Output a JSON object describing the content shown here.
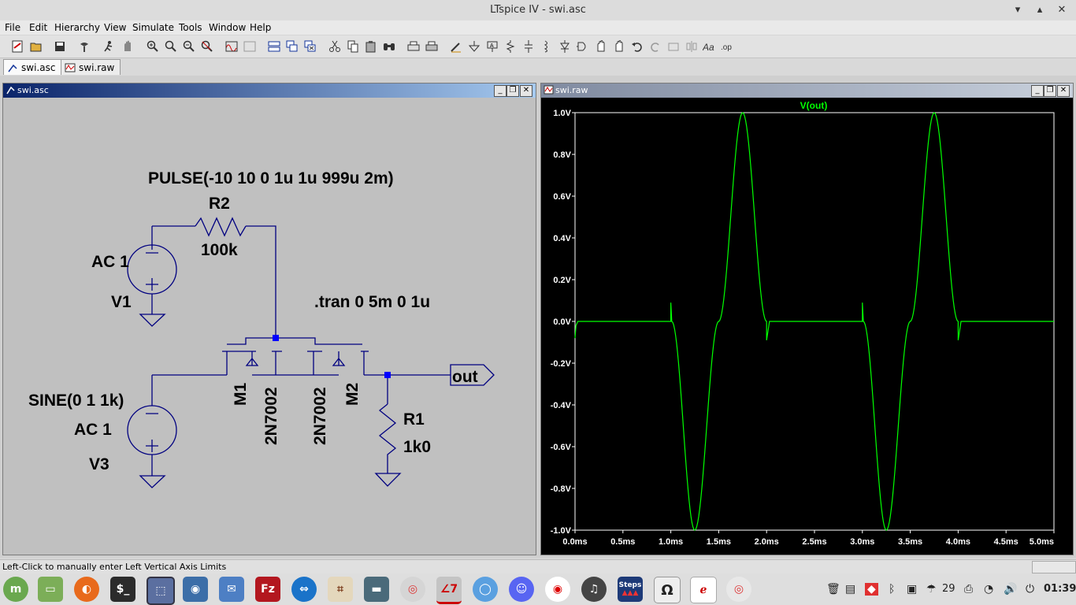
{
  "window": {
    "title": "LTspice IV - swi.asc"
  },
  "menu": [
    "File",
    "Edit",
    "Hierarchy",
    "View",
    "Simulate",
    "Tools",
    "Window",
    "Help"
  ],
  "tabs": [
    {
      "label": "swi.asc",
      "active": true
    },
    {
      "label": "swi.raw",
      "active": false
    }
  ],
  "schematic": {
    "window_title": "swi.asc",
    "pulse_label": "PULSE(-10 10 0 1u 1u 999u 2m)",
    "r2_name": "R2",
    "r2_value": "100k",
    "v1_ac": "AC 1",
    "v1_name": "V1",
    "tran": ".tran 0 5m 0 1u",
    "sine_label": "SINE(0 1 1k)",
    "v3_ac": "AC 1",
    "v3_name": "V3",
    "m1_name": "M1",
    "m1_model": "2N7002",
    "m2_model": "2N7002",
    "m2_name": "M2",
    "out_label": "out",
    "r1_name": "R1",
    "r1_value": "1k0"
  },
  "waveform": {
    "window_title": "swi.raw",
    "trace_label": "V(out)",
    "trace_color": "#00ff00"
  },
  "chart_data": {
    "type": "line",
    "title": "V(out)",
    "xlabel": "",
    "ylabel": "",
    "xlim": [
      0,
      5.0
    ],
    "ylim": [
      -1.0,
      1.0
    ],
    "x_ticks": [
      "0.0ms",
      "0.5ms",
      "1.0ms",
      "1.5ms",
      "2.0ms",
      "2.5ms",
      "3.0ms",
      "3.5ms",
      "4.0ms",
      "4.5ms",
      "5.0ms"
    ],
    "y_ticks": [
      "1.0V",
      "0.8V",
      "0.6V",
      "0.4V",
      "0.2V",
      "0.0V",
      "-0.2V",
      "-0.4V",
      "-0.6V",
      "-0.8V",
      "-1.0V"
    ],
    "series": [
      {
        "name": "V(out)",
        "x": [
          0,
          0.01,
          0.03,
          0.1,
          1.0,
          1.0,
          1.01,
          1.25,
          1.5,
          1.75,
          2.0,
          2.0,
          2.03,
          2.1,
          3.0,
          3.0,
          3.01,
          3.25,
          3.5,
          3.75,
          4.0,
          4.0,
          4.03,
          4.1,
          5.0
        ],
        "y": [
          -0.08,
          -0.02,
          0.0,
          0.0,
          0.0,
          0.09,
          0.0,
          -1.0,
          0.0,
          1.0,
          0.0,
          -0.09,
          0.0,
          0.0,
          0.0,
          0.09,
          0.0,
          -1.0,
          0.0,
          1.0,
          0.0,
          -0.09,
          0.0,
          0.0,
          0.0
        ]
      }
    ],
    "grid": false
  },
  "status": {
    "text": "Left-Click to manually enter Left Vertical Axis Limits"
  },
  "taskbar": {
    "apps": [
      "menu",
      "files",
      "firefox",
      "terminal",
      "screenshot",
      "camera",
      "mail",
      "filezilla",
      "teamviewer",
      "kicad",
      "display",
      "chromium",
      "ltspice",
      "browser",
      "discord",
      "recorder",
      "audio",
      "steps",
      "charmap",
      "notes",
      "chrome"
    ],
    "steps_label": "Steps",
    "charmap_label": "Ω",
    "tray_weather": "29",
    "clock": "01:39"
  }
}
